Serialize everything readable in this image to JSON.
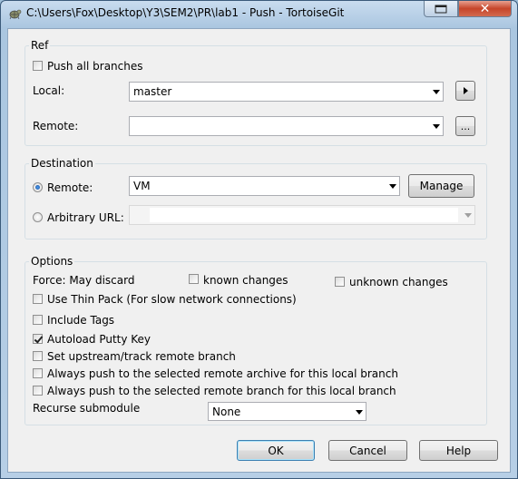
{
  "window": {
    "title": "C:\\Users\\Fox\\Desktop\\Y3\\SEM2\\PR\\lab1 - Push - TortoiseGit",
    "close_glyph": "✕"
  },
  "ref": {
    "label": "Ref",
    "push_all_branches": {
      "label": "Push all branches",
      "checked": false
    },
    "local": {
      "label": "Local:",
      "value": "master"
    },
    "remote": {
      "label": "Remote:",
      "value": ""
    },
    "browse_label": "..."
  },
  "destination": {
    "label": "Destination",
    "remote": {
      "label": "Remote:",
      "selected": true,
      "value": "VM"
    },
    "manage_label": "Manage",
    "arbitrary_url": {
      "label": "Arbitrary URL:",
      "selected": false,
      "value": ""
    }
  },
  "options": {
    "label": "Options",
    "force_label": "Force: May discard",
    "known_changes": {
      "label": "known changes",
      "checked": false
    },
    "unknown_changes": {
      "label": "unknown changes",
      "checked": false
    },
    "use_thin_pack": {
      "label": "Use Thin Pack (For slow network connections)",
      "checked": false
    },
    "include_tags": {
      "label": "Include Tags",
      "checked": false
    },
    "autoload_putty_key": {
      "label": "Autoload Putty Key",
      "checked": true
    },
    "set_upstream": {
      "label": "Set upstream/track remote branch",
      "checked": false
    },
    "always_push_archive": {
      "label": "Always push to the selected remote archive for this local branch",
      "checked": false
    },
    "always_push_branch": {
      "label": "Always push to the selected remote branch for this local branch",
      "checked": false
    },
    "recurse_submodule": {
      "label": "Recurse submodule",
      "value": "None"
    }
  },
  "buttons": {
    "ok": "OK",
    "cancel": "Cancel",
    "help": "Help"
  }
}
